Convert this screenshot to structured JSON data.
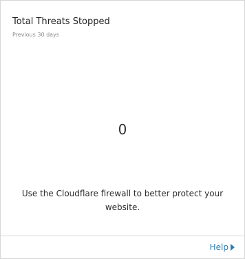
{
  "card": {
    "title": "Total Threats Stopped",
    "subtitle": "Previous 30 days",
    "value": "0",
    "message": "Use the Cloudflare firewall to better protect your website.",
    "footer": {
      "help_label": "Help",
      "help_icon": "caret-right-icon"
    }
  },
  "colors": {
    "link": "#2c7cb0",
    "border": "#d6d6d6",
    "subtitle": "#8a8a8a"
  }
}
